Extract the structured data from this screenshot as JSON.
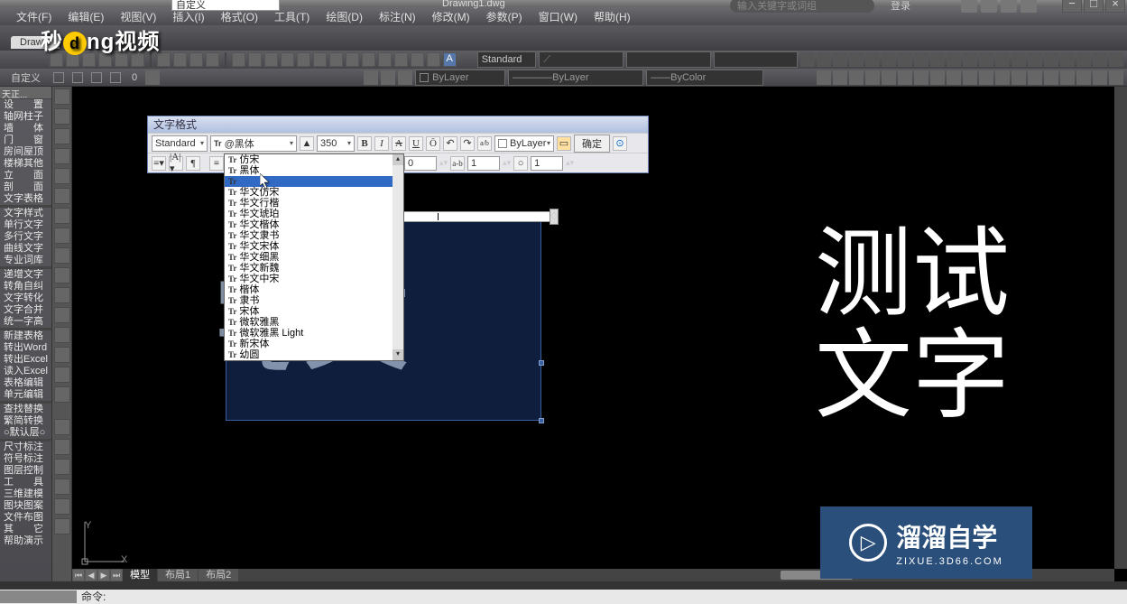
{
  "title_dropdown": "自定义",
  "top": {
    "center": "Drawing1.dwg",
    "search_placeholder": "输入关键字或词组",
    "login": "登录"
  },
  "menu": [
    "文件(F)",
    "编辑(E)",
    "视图(V)",
    "插入(I)",
    "格式(O)",
    "工具(T)",
    "绘图(D)",
    "标注(N)",
    "修改(M)",
    "参数(P)",
    "窗口(W)",
    "帮助(H)"
  ],
  "band2": {
    "logo_text": "秒d*ng视频",
    "drawing_tab": "Draw..."
  },
  "toolbar1": {
    "standard": "Standard"
  },
  "toolbar2": {
    "label1": "自定义",
    "bylayer1": "ByLayer",
    "bylayer2": "ByLayer",
    "bycolor": "ByColor",
    "num": "0"
  },
  "leftpanel": {
    "header": "天正...",
    "items": [
      "设　　置",
      "轴网柱子",
      "墙　　体",
      "门　　窗",
      "房间屋顶",
      "楼梯其他",
      "立　　面",
      "剖　　面",
      "文字表格",
      "",
      "文字样式",
      "单行文字",
      "多行文字",
      "曲线文字",
      "专业词库",
      "",
      "递增文字",
      "转角自纠",
      "文字转化",
      "文字合并",
      "统一字高",
      "",
      "新建表格",
      "转出Word",
      "转出Excel",
      "读入Excel",
      "表格编辑",
      "单元编辑",
      "",
      "查找替换",
      "繁简转换",
      "○默认层○",
      "",
      "尺寸标注",
      "符号标注",
      "图层控制",
      "工　　具",
      "三维建模",
      "图块图案",
      "文件布图",
      "其　　它",
      "帮助演示"
    ]
  },
  "text_editor": {
    "title": "文字格式",
    "style": "Standard",
    "font": "@黑体",
    "size": "350",
    "bylayer": "ByLayer",
    "ok": "确定",
    "o_val": "0",
    "ab_val": "1",
    "o2_val": "1"
  },
  "font_dropdown": {
    "items": [
      "仿宋",
      "黑体",
      "",
      "华文仿宋",
      "华文行楷",
      "华文琥珀",
      "华文楷体",
      "华文隶书",
      "华文宋体",
      "华文细黑",
      "华文新魏",
      "华文中宋",
      "楷体",
      "隶书",
      "宋体",
      "微软雅黑",
      "微软雅黑 Light",
      "新宋体",
      "幼圆"
    ],
    "selected_index": 2
  },
  "canvas": {
    "big_text_line1": "测试",
    "big_text_line2": "文字",
    "inner_text": "文字",
    "ucs_y": "Y",
    "ucs_x": "X",
    "tabs": [
      "模型",
      "布局1",
      "布局2"
    ],
    "active_tab": 0
  },
  "watermark": {
    "brand": "溜溜自学",
    "url": "ZIXUE.3D66.COM",
    "play": "▷"
  },
  "cmd": {
    "label": "命令:"
  }
}
